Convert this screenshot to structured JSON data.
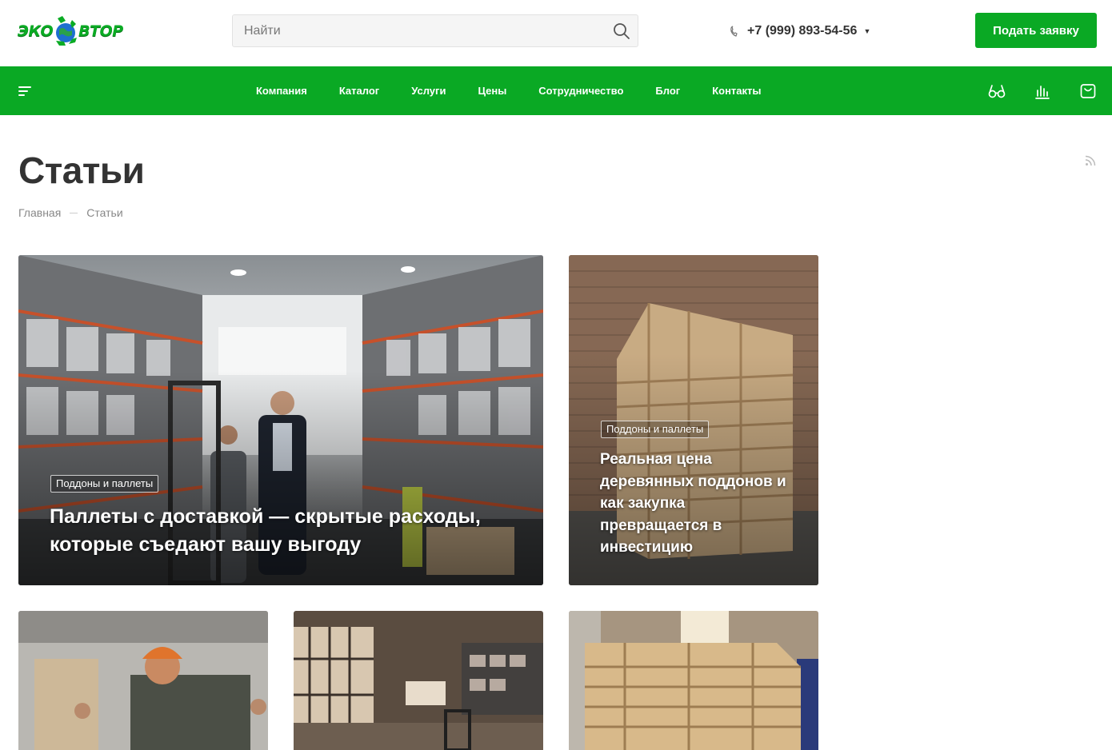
{
  "header": {
    "logo_left": "ЭКО",
    "logo_right": "ВТОР",
    "search_placeholder": "Найти",
    "phone": "+7 (999) 893-54-56",
    "cta_label": "Подать заявку"
  },
  "nav": {
    "items": [
      "Компания",
      "Каталог",
      "Услуги",
      "Цены",
      "Сотрудничество",
      "Блог",
      "Контакты"
    ]
  },
  "page": {
    "title": "Статьи",
    "breadcrumb": [
      "Главная",
      "Статьи"
    ]
  },
  "articles": [
    {
      "tag": "Поддоны и паллеты",
      "title": "Паллеты с доставкой — скрытые расходы, которые съедают вашу выгоду"
    },
    {
      "tag": "Поддоны и паллеты",
      "title": "Реальная цена деревянных поддонов и как закупка превращается в инвестицию"
    }
  ],
  "colors": {
    "brand_green": "#0aa924",
    "text": "#333333",
    "muted": "#888888"
  }
}
